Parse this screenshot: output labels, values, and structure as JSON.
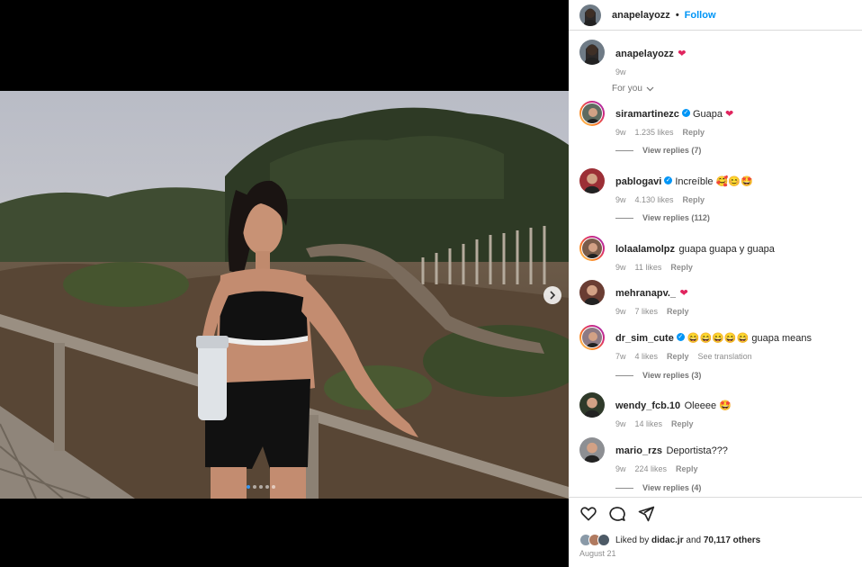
{
  "post": {
    "username": "anapelayozz",
    "separator": "•",
    "follow_label": "Follow",
    "caption_emoji": "❤",
    "caption_age": "9w",
    "for_you_label": "For you"
  },
  "comments": [
    {
      "user": "siramartinezc",
      "verified": true,
      "text": "Guapa",
      "emoji": "❤",
      "age": "9w",
      "likes": "1.235 likes",
      "reply": "Reply",
      "view_replies": "View replies (7)",
      "story_ring": true
    },
    {
      "user": "pablogavi",
      "verified": true,
      "text": "Increíble",
      "emoji": "🥰😊🤩",
      "age": "9w",
      "likes": "4.130 likes",
      "reply": "Reply",
      "view_replies": "View replies (112)",
      "story_ring": false
    },
    {
      "user": "lolaalamolpz",
      "verified": false,
      "text": "guapa guapa y guapa",
      "emoji": "",
      "age": "9w",
      "likes": "11 likes",
      "reply": "Reply",
      "view_replies": "",
      "story_ring": true
    },
    {
      "user": "mehranapv._",
      "verified": false,
      "text": "",
      "emoji": "❤",
      "age": "9w",
      "likes": "7 likes",
      "reply": "Reply",
      "view_replies": "",
      "story_ring": false
    },
    {
      "user": "dr_sim_cute",
      "verified": true,
      "text": "guapa means",
      "emoji": "😄😄😄😄😄",
      "age": "7w",
      "likes": "4 likes",
      "reply": "Reply",
      "extra": "See translation",
      "view_replies": "View replies (3)",
      "story_ring": true
    },
    {
      "user": "wendy_fcb.10",
      "verified": false,
      "text": "Oleeee",
      "emoji": "🤩",
      "age": "9w",
      "likes": "14 likes",
      "reply": "Reply",
      "view_replies": "",
      "story_ring": false
    },
    {
      "user": "mario_rzs",
      "verified": false,
      "text": "Deportista???",
      "emoji": "",
      "age": "9w",
      "likes": "224 likes",
      "reply": "Reply",
      "view_replies": "View replies (4)",
      "story_ring": false
    }
  ],
  "likes_bar": {
    "liked_by_prefix": "Liked by",
    "liked_by_user": "didac.jr",
    "and_word": "and",
    "others": "70,117 others",
    "date": "August 21"
  },
  "carousel": {
    "total": 5,
    "active": 0
  },
  "icons": [
    "heart-icon",
    "comment-icon",
    "share-icon",
    "chevron-right-icon",
    "chevron-down-icon",
    "verified-icon"
  ],
  "colors": {
    "link": "#0095f6",
    "heart": "#e0245e",
    "muted": "#8e8e8e",
    "text": "#262626"
  }
}
